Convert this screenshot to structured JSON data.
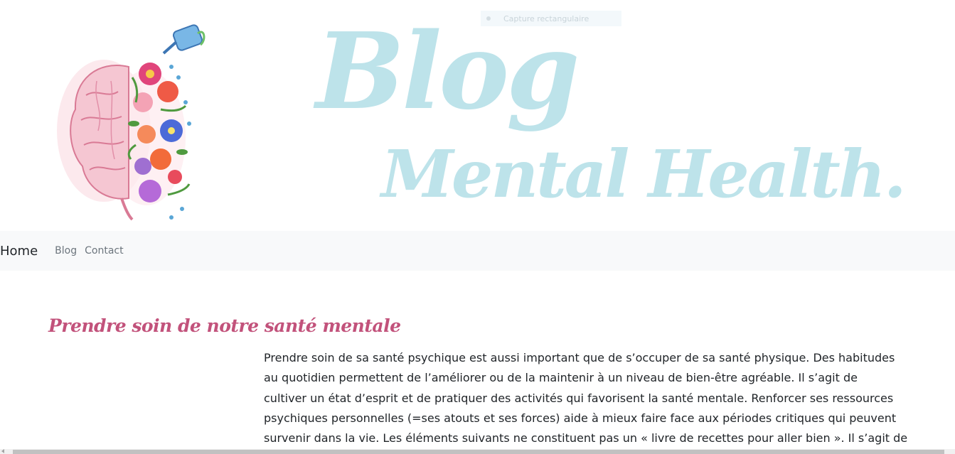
{
  "header": {
    "title_line1": "Blog",
    "title_line2": "Mental Health.",
    "logo_icon": "brain-flowers-watering-can-illustration"
  },
  "overlay": {
    "capture_label": "Capture rectangulaire"
  },
  "nav": {
    "brand": "Home",
    "links": [
      "Blog",
      "Contact"
    ]
  },
  "post": {
    "title": "Prendre soin de notre santé mentale",
    "body_lines": [
      "Prendre soin de sa santé psychique est aussi important que de s’occuper de sa santé physique. Des habitudes",
      "au quotidien permettent de l’améliorer ou de la maintenir à un niveau de bien-être agréable. Il s’agit de",
      "cultiver un état d’esprit et de pratiquer des activités qui favorisent la santé mentale. Renforcer ses ressources",
      "psychiques personnelles (=ses atouts et ses forces) aide à mieux faire face aux périodes critiques qui peuvent",
      "survenir dans la vie. Les éléments suivants ne constituent pas un « livre de recettes pour aller bien ». Il s’agit de"
    ]
  },
  "colors": {
    "title_blue": "#bde3ea",
    "post_title_pink": "#c2527b",
    "nav_bg": "#f8f9fa",
    "text": "#212529",
    "nav_link": "#6c757d"
  }
}
